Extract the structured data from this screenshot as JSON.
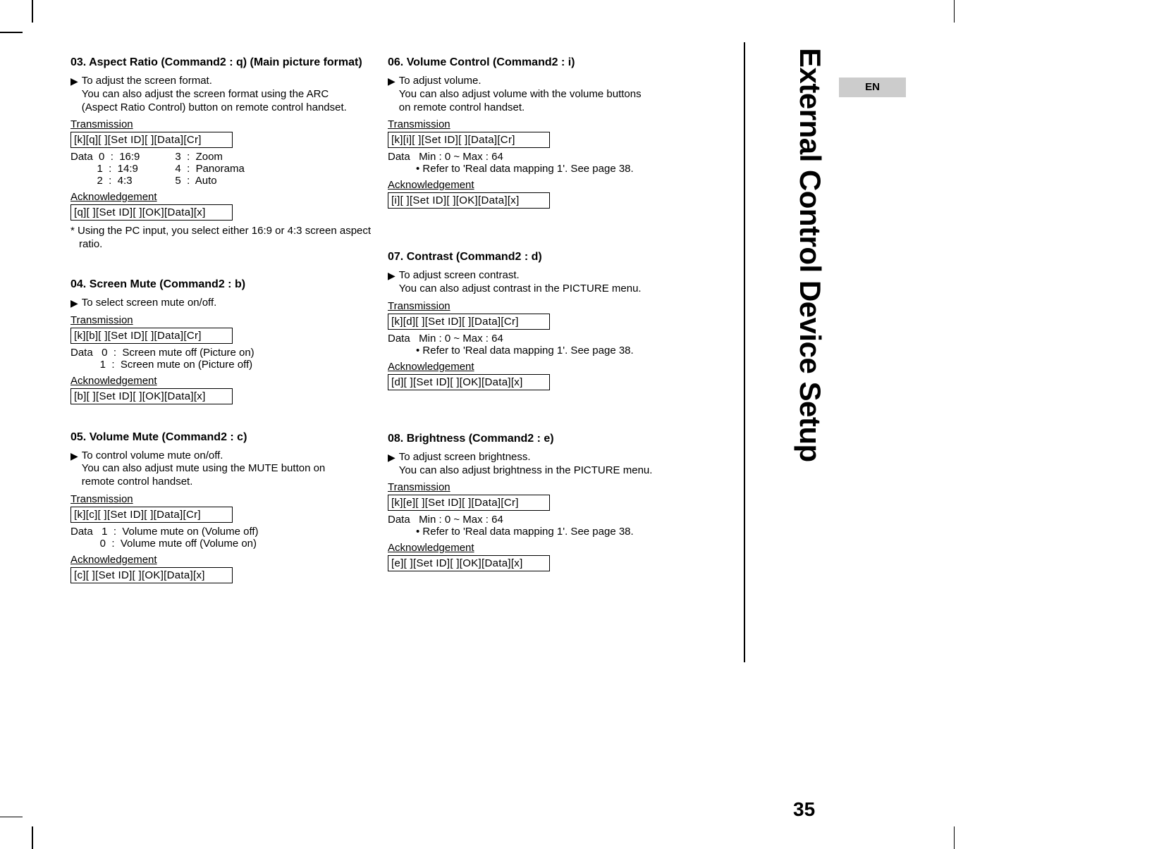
{
  "page": {
    "side_title": "External Control Device Setup",
    "page_number": "35",
    "lang": "EN"
  },
  "s03": {
    "title": "03. Aspect Ratio (Command2 : q) (Main picture format)",
    "desc1": "To adjust the screen format.",
    "desc2": "You can also adjust the screen format using the ARC",
    "desc3": "(Aspect Ratio Control) button on remote control handset.",
    "tx_label": "Transmission",
    "tx_code": "[k][q][  ][Set ID][  ][Data][Cr]",
    "data_col1_0": "Data  0  :  16:9",
    "data_col1_1": "         1  :  14:9",
    "data_col1_2": "         2  :  4:3",
    "data_col2_0": "3  :  Zoom",
    "data_col2_1": "4  :  Panorama",
    "data_col2_2": "5  :  Auto",
    "ack_label": "Acknowledgement",
    "ack_code": "[q][  ][Set ID][  ][OK][Data][x]",
    "note1": "* Using the PC input, you select either 16:9 or 4:3 screen aspect",
    "note2": "ratio."
  },
  "s04": {
    "title": "04. Screen Mute (Command2 : b)",
    "desc1": "To select screen mute on/off.",
    "tx_label": "Transmission",
    "tx_code": "[k][b][  ][Set ID][  ][Data][Cr]",
    "data0": "Data   0  :  Screen mute off (Picture on)",
    "data1": "          1  :  Screen mute on (Picture off)",
    "ack_label": "Acknowledgement",
    "ack_code": "[b][  ][Set ID][  ][OK][Data][x]"
  },
  "s05": {
    "title": "05. Volume Mute (Command2 : c)",
    "desc1": "To control volume mute on/off.",
    "desc2": "You can also adjust mute using the MUTE button on",
    "desc3": "remote control handset.",
    "tx_label": "Transmission",
    "tx_code": "[k][c][  ][Set ID][  ][Data][Cr]",
    "data0": "Data   1  :  Volume mute on (Volume off)",
    "data1": "          0  :  Volume mute off (Volume on)",
    "ack_label": "Acknowledgement",
    "ack_code": "[c][  ][Set ID][  ][OK][Data][x]"
  },
  "s06": {
    "title": "06. Volume Control (Command2 : i)",
    "desc1": "To adjust volume.",
    "desc2": "You can also adjust volume with the volume buttons",
    "desc3": "on remote control handset.",
    "tx_label": "Transmission",
    "tx_code": "[k][i][  ][Set ID][  ][Data][Cr]",
    "data0": "Data   Min : 0 ~ Max : 64",
    "bullet": "Refer to 'Real data mapping 1'. See page 38.",
    "ack_label": "Acknowledgement",
    "ack_code": "[i][  ][Set ID][  ][OK][Data][x]"
  },
  "s07": {
    "title": "07. Contrast (Command2 : d)",
    "desc1": "To adjust screen contrast.",
    "desc2": "You can also adjust contrast in the PICTURE menu.",
    "tx_label": "Transmission",
    "tx_code": "[k][d][  ][Set ID][  ][Data][Cr]",
    "data0": "Data   Min : 0 ~ Max : 64",
    "bullet": "Refer to 'Real data mapping 1'. See page 38.",
    "ack_label": "Acknowledgement",
    "ack_code": "[d][  ][Set ID][  ][OK][Data][x]"
  },
  "s08": {
    "title": "08. Brightness (Command2 : e)",
    "desc1": "To adjust screen brightness.",
    "desc2": "You can also adjust brightness in the PICTURE menu.",
    "tx_label": "Transmission",
    "tx_code": "[k][e][  ][Set ID][  ][Data][Cr]",
    "data0": "Data   Min : 0 ~ Max : 64",
    "bullet": "Refer to 'Real data mapping 1'. See page 38.",
    "ack_label": "Acknowledgement",
    "ack_code": "[e][  ][Set ID][  ][OK][Data][x]"
  }
}
